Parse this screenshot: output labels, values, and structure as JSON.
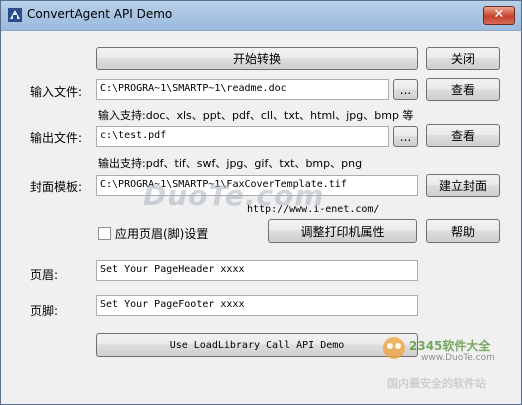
{
  "window": {
    "title": "ConvertAgent API Demo",
    "close_glyph": "✕",
    "title_bg": "#a8c4e2",
    "close_bg": "#c7422a"
  },
  "buttons": {
    "start": "开始转换",
    "close": "关闭",
    "view_input": "查看",
    "view_output": "查看",
    "create_cover": "建立封面",
    "help": "帮助",
    "printer_props": "调整打印机属性",
    "browse_input": "...",
    "browse_output": "...",
    "loadlibrary_demo": "Use LoadLibrary Call API Demo"
  },
  "labels": {
    "input_file": "输入文件:",
    "output_file": "输出文件:",
    "cover_template": "封面模板:",
    "header": "页眉:",
    "footer": "页脚:",
    "use_header_footer": "应用页眉(脚)设置"
  },
  "hints": {
    "input_support": "输入支持:doc、xls、ppt、pdf、cll、txt、html、jpg、bmp 等",
    "output_support": "输出支持:pdf、tif、swf、jpg、gif、txt、bmp、png",
    "url": "http://www.i-enet.com/"
  },
  "fields": {
    "input_path": "C:\\PROGRA~1\\SMARTP~1\\readme.doc",
    "output_path": "c:\\test.pdf",
    "cover_path": "C:\\PROGRA~1\\SMARTP~1\\FaxCoverTemplate.tif",
    "header_text": "Set Your PageHeader xxxx",
    "footer_text": "Set Your PageFooter xxxx"
  },
  "checkbox": {
    "use_header_footer_checked": false
  },
  "watermarks": {
    "duote_logo": "DuoTe.com",
    "corner_brand": "2345软件大全",
    "corner_url": "www.DuoTe.com",
    "corner_slogan": "国内最安全的软件站"
  }
}
